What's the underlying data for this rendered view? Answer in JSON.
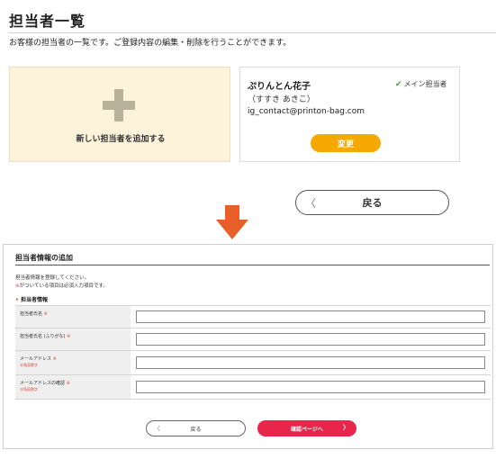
{
  "page": {
    "title": "担当者一覧",
    "description": "お客様の担当者の一覧です。ご登録内容の編集・削除を行うことができます。"
  },
  "add_card": {
    "label": "新しい担当者を追加する",
    "icon": "plus-icon"
  },
  "contact": {
    "name": "ぷりんとん花子",
    "kana": "（すすき あきこ）",
    "email": "ig_contact@printon-bag.com",
    "main_label": "メイン担当者",
    "main_icon": "check-icon",
    "edit_label": "変更"
  },
  "back_button": {
    "label": "戻る",
    "chevron": "〈"
  },
  "form": {
    "title": "担当者情報の追加",
    "desc1": "担当者情報を登録してください。",
    "desc2_mark": "※",
    "desc2_text": "がついている項目は必須入力項目です。",
    "section_mark": "•",
    "section_title": "担当者情報",
    "fields": [
      {
        "label": "担当者氏名",
        "req": "※",
        "sub": "",
        "value": ""
      },
      {
        "label": "担当者氏名 (ふりがな)",
        "req": "※",
        "sub": "",
        "value": ""
      },
      {
        "label": "メールアドレス",
        "req": "※",
        "sub": "半角英数字",
        "value": ""
      },
      {
        "label": "メールアドレスの確認",
        "req": "※",
        "sub": "半角英数字",
        "value": ""
      }
    ],
    "back_label": "戻る",
    "back_chevron": "〈",
    "confirm_label": "確認ページへ",
    "confirm_chevron": "〉"
  },
  "colors": {
    "add_card_bg": "#fcf3da",
    "edit_button": "#f5a800",
    "arrow": "#e95f2a",
    "confirm_button": "#e8254a",
    "required": "#e0463b"
  }
}
